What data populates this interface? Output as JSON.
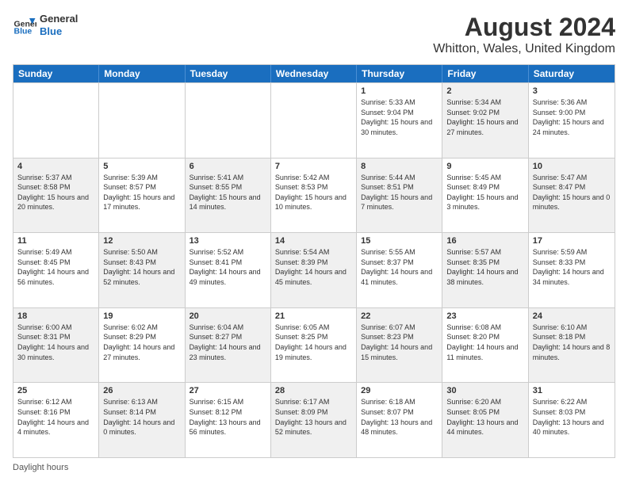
{
  "header": {
    "logo_general": "General",
    "logo_blue": "Blue",
    "title": "August 2024",
    "subtitle": "Whitton, Wales, United Kingdom"
  },
  "days_of_week": [
    "Sunday",
    "Monday",
    "Tuesday",
    "Wednesday",
    "Thursday",
    "Friday",
    "Saturday"
  ],
  "footer_note": "Daylight hours",
  "weeks": [
    [
      {
        "day": "",
        "sunrise": "",
        "sunset": "",
        "daylight": "",
        "empty": true
      },
      {
        "day": "",
        "sunrise": "",
        "sunset": "",
        "daylight": "",
        "empty": true
      },
      {
        "day": "",
        "sunrise": "",
        "sunset": "",
        "daylight": "",
        "empty": true
      },
      {
        "day": "",
        "sunrise": "",
        "sunset": "",
        "daylight": "",
        "empty": true
      },
      {
        "day": "1",
        "sunrise": "Sunrise: 5:33 AM",
        "sunset": "Sunset: 9:04 PM",
        "daylight": "Daylight: 15 hours and 30 minutes.",
        "shaded": false
      },
      {
        "day": "2",
        "sunrise": "Sunrise: 5:34 AM",
        "sunset": "Sunset: 9:02 PM",
        "daylight": "Daylight: 15 hours and 27 minutes.",
        "shaded": true
      },
      {
        "day": "3",
        "sunrise": "Sunrise: 5:36 AM",
        "sunset": "Sunset: 9:00 PM",
        "daylight": "Daylight: 15 hours and 24 minutes.",
        "shaded": false
      }
    ],
    [
      {
        "day": "4",
        "sunrise": "Sunrise: 5:37 AM",
        "sunset": "Sunset: 8:58 PM",
        "daylight": "Daylight: 15 hours and 20 minutes.",
        "shaded": true
      },
      {
        "day": "5",
        "sunrise": "Sunrise: 5:39 AM",
        "sunset": "Sunset: 8:57 PM",
        "daylight": "Daylight: 15 hours and 17 minutes.",
        "shaded": false
      },
      {
        "day": "6",
        "sunrise": "Sunrise: 5:41 AM",
        "sunset": "Sunset: 8:55 PM",
        "daylight": "Daylight: 15 hours and 14 minutes.",
        "shaded": true
      },
      {
        "day": "7",
        "sunrise": "Sunrise: 5:42 AM",
        "sunset": "Sunset: 8:53 PM",
        "daylight": "Daylight: 15 hours and 10 minutes.",
        "shaded": false
      },
      {
        "day": "8",
        "sunrise": "Sunrise: 5:44 AM",
        "sunset": "Sunset: 8:51 PM",
        "daylight": "Daylight: 15 hours and 7 minutes.",
        "shaded": true
      },
      {
        "day": "9",
        "sunrise": "Sunrise: 5:45 AM",
        "sunset": "Sunset: 8:49 PM",
        "daylight": "Daylight: 15 hours and 3 minutes.",
        "shaded": false
      },
      {
        "day": "10",
        "sunrise": "Sunrise: 5:47 AM",
        "sunset": "Sunset: 8:47 PM",
        "daylight": "Daylight: 15 hours and 0 minutes.",
        "shaded": true
      }
    ],
    [
      {
        "day": "11",
        "sunrise": "Sunrise: 5:49 AM",
        "sunset": "Sunset: 8:45 PM",
        "daylight": "Daylight: 14 hours and 56 minutes.",
        "shaded": false
      },
      {
        "day": "12",
        "sunrise": "Sunrise: 5:50 AM",
        "sunset": "Sunset: 8:43 PM",
        "daylight": "Daylight: 14 hours and 52 minutes.",
        "shaded": true
      },
      {
        "day": "13",
        "sunrise": "Sunrise: 5:52 AM",
        "sunset": "Sunset: 8:41 PM",
        "daylight": "Daylight: 14 hours and 49 minutes.",
        "shaded": false
      },
      {
        "day": "14",
        "sunrise": "Sunrise: 5:54 AM",
        "sunset": "Sunset: 8:39 PM",
        "daylight": "Daylight: 14 hours and 45 minutes.",
        "shaded": true
      },
      {
        "day": "15",
        "sunrise": "Sunrise: 5:55 AM",
        "sunset": "Sunset: 8:37 PM",
        "daylight": "Daylight: 14 hours and 41 minutes.",
        "shaded": false
      },
      {
        "day": "16",
        "sunrise": "Sunrise: 5:57 AM",
        "sunset": "Sunset: 8:35 PM",
        "daylight": "Daylight: 14 hours and 38 minutes.",
        "shaded": true
      },
      {
        "day": "17",
        "sunrise": "Sunrise: 5:59 AM",
        "sunset": "Sunset: 8:33 PM",
        "daylight": "Daylight: 14 hours and 34 minutes.",
        "shaded": false
      }
    ],
    [
      {
        "day": "18",
        "sunrise": "Sunrise: 6:00 AM",
        "sunset": "Sunset: 8:31 PM",
        "daylight": "Daylight: 14 hours and 30 minutes.",
        "shaded": true
      },
      {
        "day": "19",
        "sunrise": "Sunrise: 6:02 AM",
        "sunset": "Sunset: 8:29 PM",
        "daylight": "Daylight: 14 hours and 27 minutes.",
        "shaded": false
      },
      {
        "day": "20",
        "sunrise": "Sunrise: 6:04 AM",
        "sunset": "Sunset: 8:27 PM",
        "daylight": "Daylight: 14 hours and 23 minutes.",
        "shaded": true
      },
      {
        "day": "21",
        "sunrise": "Sunrise: 6:05 AM",
        "sunset": "Sunset: 8:25 PM",
        "daylight": "Daylight: 14 hours and 19 minutes.",
        "shaded": false
      },
      {
        "day": "22",
        "sunrise": "Sunrise: 6:07 AM",
        "sunset": "Sunset: 8:23 PM",
        "daylight": "Daylight: 14 hours and 15 minutes.",
        "shaded": true
      },
      {
        "day": "23",
        "sunrise": "Sunrise: 6:08 AM",
        "sunset": "Sunset: 8:20 PM",
        "daylight": "Daylight: 14 hours and 11 minutes.",
        "shaded": false
      },
      {
        "day": "24",
        "sunrise": "Sunrise: 6:10 AM",
        "sunset": "Sunset: 8:18 PM",
        "daylight": "Daylight: 14 hours and 8 minutes.",
        "shaded": true
      }
    ],
    [
      {
        "day": "25",
        "sunrise": "Sunrise: 6:12 AM",
        "sunset": "Sunset: 8:16 PM",
        "daylight": "Daylight: 14 hours and 4 minutes.",
        "shaded": false
      },
      {
        "day": "26",
        "sunrise": "Sunrise: 6:13 AM",
        "sunset": "Sunset: 8:14 PM",
        "daylight": "Daylight: 14 hours and 0 minutes.",
        "shaded": true
      },
      {
        "day": "27",
        "sunrise": "Sunrise: 6:15 AM",
        "sunset": "Sunset: 8:12 PM",
        "daylight": "Daylight: 13 hours and 56 minutes.",
        "shaded": false
      },
      {
        "day": "28",
        "sunrise": "Sunrise: 6:17 AM",
        "sunset": "Sunset: 8:09 PM",
        "daylight": "Daylight: 13 hours and 52 minutes.",
        "shaded": true
      },
      {
        "day": "29",
        "sunrise": "Sunrise: 6:18 AM",
        "sunset": "Sunset: 8:07 PM",
        "daylight": "Daylight: 13 hours and 48 minutes.",
        "shaded": false
      },
      {
        "day": "30",
        "sunrise": "Sunrise: 6:20 AM",
        "sunset": "Sunset: 8:05 PM",
        "daylight": "Daylight: 13 hours and 44 minutes.",
        "shaded": true
      },
      {
        "day": "31",
        "sunrise": "Sunrise: 6:22 AM",
        "sunset": "Sunset: 8:03 PM",
        "daylight": "Daylight: 13 hours and 40 minutes.",
        "shaded": false
      }
    ]
  ]
}
